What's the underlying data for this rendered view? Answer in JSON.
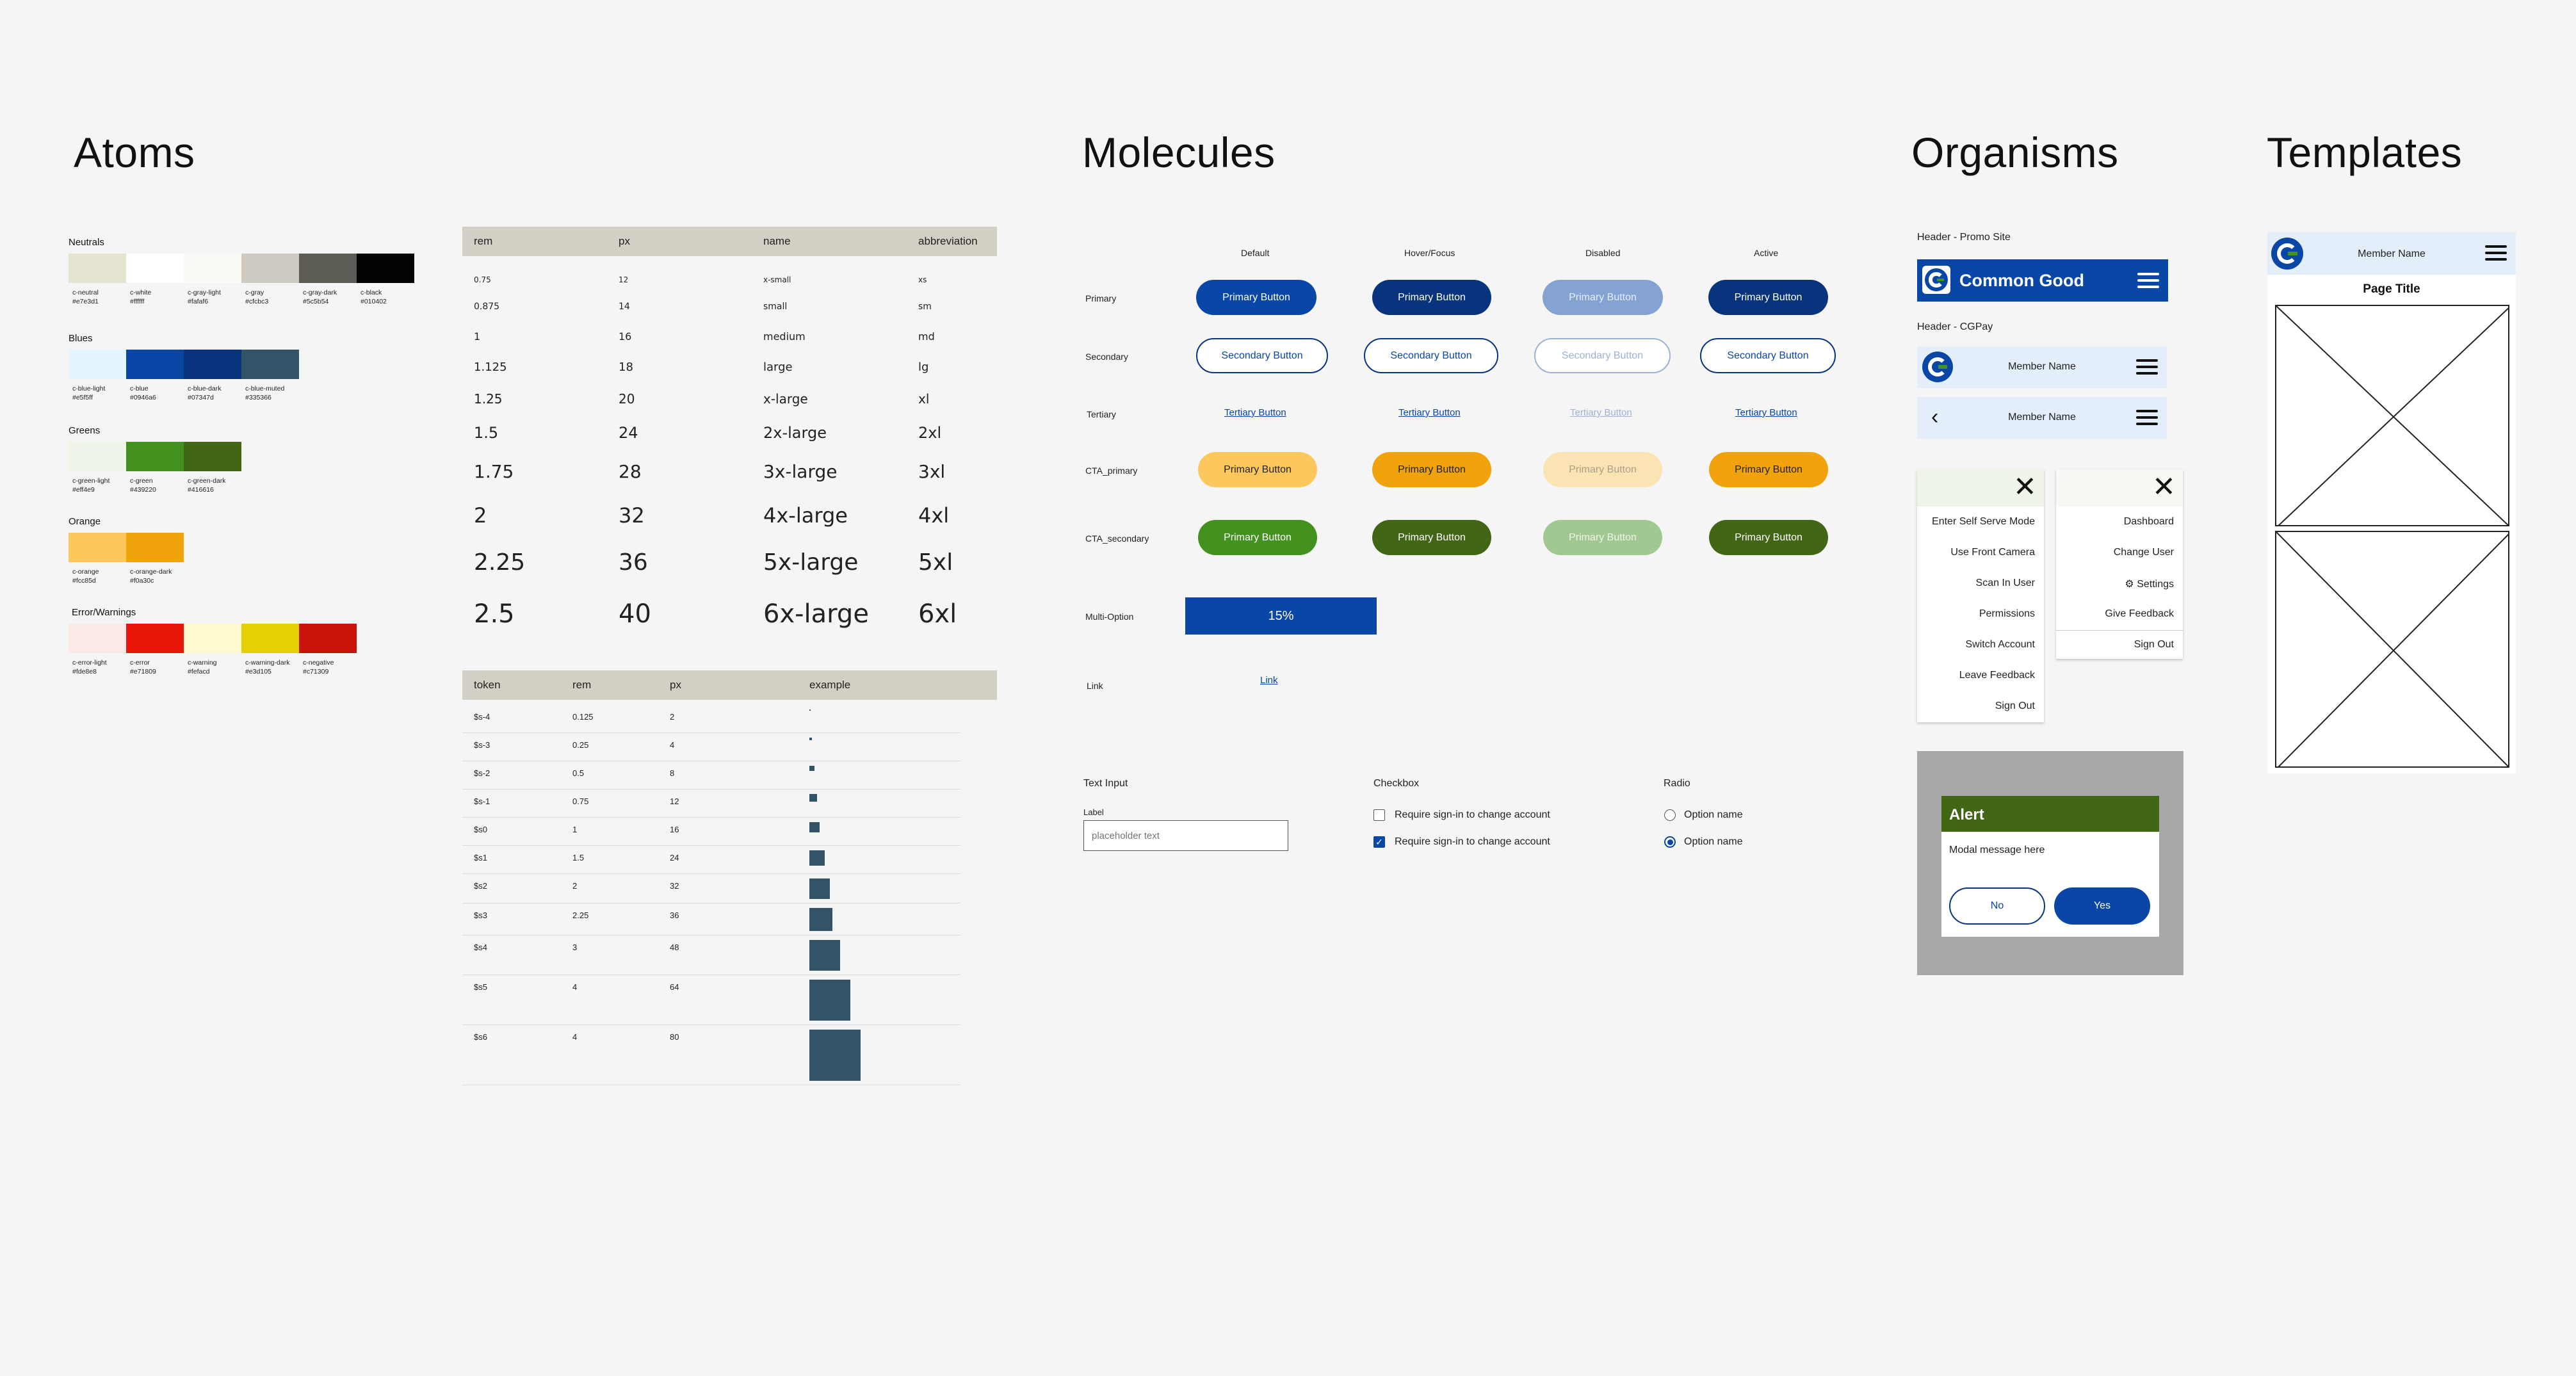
{
  "sections": {
    "atoms": "Atoms",
    "molecules": "Molecules",
    "organisms": "Organisms",
    "templates": "Templates"
  },
  "colors": {
    "neutrals": {
      "label": "Neutrals",
      "items": [
        {
          "name": "c-neutral",
          "hex": "#e7e3d1"
        },
        {
          "name": "c-white",
          "hex": "#ffffff"
        },
        {
          "name": "c-gray-light",
          "hex": "#fafaf6"
        },
        {
          "name": "c-gray",
          "hex": "#cfcbc3"
        },
        {
          "name": "c-gray-dark",
          "hex": "#5c5b54"
        },
        {
          "name": "c-black",
          "hex": "#010402"
        }
      ]
    },
    "blues": {
      "label": "Blues",
      "items": [
        {
          "name": "c-blue-light",
          "hex": "#e5f5ff"
        },
        {
          "name": "c-blue",
          "hex": "#0946a6"
        },
        {
          "name": "c-blue-dark",
          "hex": "#07347d"
        },
        {
          "name": "c-blue-muted",
          "hex": "#335366"
        }
      ]
    },
    "greens": {
      "label": "Greens",
      "items": [
        {
          "name": "c-green-light",
          "hex": "#eff4e9"
        },
        {
          "name": "c-green",
          "hex": "#439220"
        },
        {
          "name": "c-green-dark",
          "hex": "#416616"
        }
      ]
    },
    "orange": {
      "label": "Orange",
      "items": [
        {
          "name": "c-orange",
          "hex": "#fcc85d"
        },
        {
          "name": "c-orange-dark",
          "hex": "#f0a30c"
        }
      ]
    },
    "errors": {
      "label": "Error/Warnings",
      "items": [
        {
          "name": "c-error-light",
          "hex": "#fde8e8"
        },
        {
          "name": "c-error",
          "hex": "#e71809"
        },
        {
          "name": "c-warning",
          "hex": "#fefacd"
        },
        {
          "name": "c-warning-dark",
          "hex": "#e3d105"
        },
        {
          "name": "c-negative",
          "hex": "#c71309"
        }
      ]
    }
  },
  "type_scale": {
    "headers": [
      "rem",
      "px",
      "name",
      "abbreviation"
    ],
    "rows": [
      [
        "0.75",
        "12",
        "x-small",
        "xs"
      ],
      [
        "0.875",
        "14",
        "small",
        "sm"
      ],
      [
        "1",
        "16",
        "medium",
        "md"
      ],
      [
        "1.125",
        "18",
        "large",
        "lg"
      ],
      [
        "1.25",
        "20",
        "x-large",
        "xl"
      ],
      [
        "1.5",
        "24",
        "2x-large",
        "2xl"
      ],
      [
        "1.75",
        "28",
        "3x-large",
        "3xl"
      ],
      [
        "2",
        "32",
        "4x-large",
        "4xl"
      ],
      [
        "2.25",
        "36",
        "5x-large",
        "5xl"
      ],
      [
        "2.5",
        "40",
        "6x-large",
        "6xl"
      ]
    ]
  },
  "spacing": {
    "headers": [
      "token",
      "rem",
      "px",
      "example"
    ],
    "rows": [
      {
        "token": "$s-4",
        "rem": "0.125",
        "px": "2"
      },
      {
        "token": "$s-3",
        "rem": "0.25",
        "px": "4"
      },
      {
        "token": "$s-2",
        "rem": "0.5",
        "px": "8"
      },
      {
        "token": "$s-1",
        "rem": "0.75",
        "px": "12"
      },
      {
        "token": "$s0",
        "rem": "1",
        "px": "16"
      },
      {
        "token": "$s1",
        "rem": "1.5",
        "px": "24"
      },
      {
        "token": "$s2",
        "rem": "2",
        "px": "32"
      },
      {
        "token": "$s3",
        "rem": "2.25",
        "px": "36"
      },
      {
        "token": "$s4",
        "rem": "3",
        "px": "48"
      },
      {
        "token": "$s5",
        "rem": "4",
        "px": "64"
      },
      {
        "token": "$s6",
        "rem": "4",
        "px": "80"
      }
    ]
  },
  "molecules": {
    "states": [
      "Default",
      "Hover/Focus",
      "Disabled",
      "Active"
    ],
    "rows": {
      "primary": "Primary",
      "secondary": "Secondary",
      "tertiary": "Tertiary",
      "cta_primary": "CTA_primary",
      "cta_secondary": "CTA_secondary",
      "multi_option": "Multi-Option",
      "link": "Link"
    },
    "labels": {
      "primary": "Primary Button",
      "secondary": "Secondary Button",
      "tertiary": "Tertiary Button",
      "link": "Link"
    },
    "multi_option_value": "15%",
    "text_input": {
      "title": "Text Input",
      "label": "Label",
      "placeholder": "placeholder text"
    },
    "checkbox": {
      "title": "Checkbox",
      "items": [
        "Require sign-in to change account",
        "Require sign-in to change account"
      ]
    },
    "radio": {
      "title": "Radio",
      "items": [
        "Option name",
        "Option name"
      ]
    }
  },
  "organisms": {
    "promo_label": "Header - Promo Site",
    "promo_title": "Common Good",
    "cgpay_label": "Header - CGPay",
    "member_name": "Member Name",
    "menu_left": [
      "Enter Self Serve Mode",
      "Use Front Camera",
      "Scan In User",
      "Permissions",
      "Switch Account",
      "Leave Feedback",
      "Sign Out"
    ],
    "menu_right": [
      "Dashboard",
      "Change User",
      "Settings",
      "Give Feedback",
      "Sign Out"
    ],
    "alert": {
      "title": "Alert",
      "message": "Modal message here",
      "no": "No",
      "yes": "Yes"
    }
  },
  "templates": {
    "member_name": "Member Name",
    "page_title": "Page Title"
  }
}
